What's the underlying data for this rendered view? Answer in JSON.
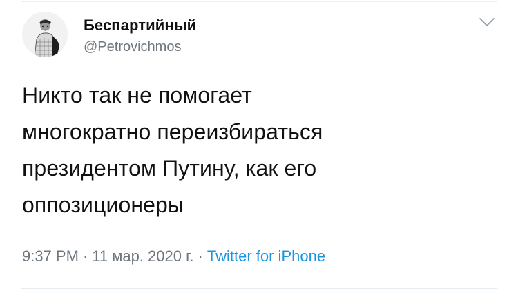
{
  "tweet": {
    "author": {
      "display_name": "Беспартийный",
      "handle": "@Petrovichmos",
      "avatar_icon": "portrait-sketch-icon"
    },
    "menu_icon": "chevron-down-icon",
    "text": "Никто так не помогает\nмногократно переизбираться\nпрезидентом Путину, как его\nоппозиционеры",
    "time": "9:37 PM",
    "separator": "·",
    "date": "11 мар. 2020 г.",
    "source": "Twitter for iPhone"
  },
  "colors": {
    "text": "#111111",
    "muted": "#6e767d",
    "link": "#1b95e0",
    "divider": "#e6ecf0"
  }
}
